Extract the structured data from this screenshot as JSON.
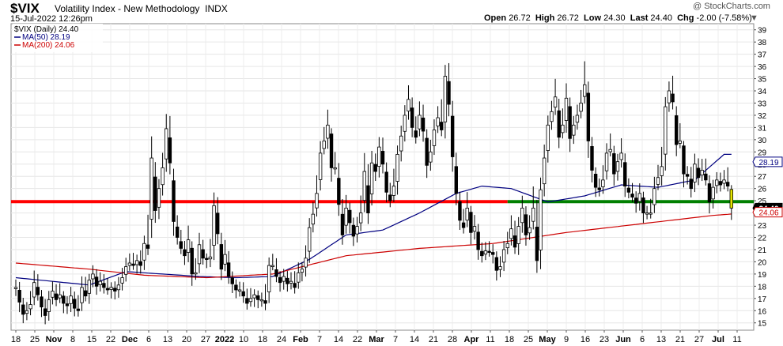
{
  "header": {
    "symbol": "$VIX",
    "name": "Volatility Index - New Methodology",
    "exchange": "INDX",
    "date": "15-Jul-2022 12:26pm",
    "watermark": "@ StockCharts.com",
    "open_label": "Open",
    "open": "26.72",
    "high_label": "High",
    "high": "26.72",
    "low_label": "Low",
    "low": "24.30",
    "last_label": "Last",
    "last": "24.40",
    "chg_label": "Chg",
    "chg": "-2.00 (-7.58%)",
    "menu_icon": "caret-down-icon"
  },
  "chart_data": {
    "type": "candlestick",
    "legend": {
      "placement": "top-left",
      "items": [
        "$VIX (Daily) 24.40",
        "MA(50) 28.19",
        "MA(200) 24.06"
      ]
    },
    "y_axis": {
      "side": "right",
      "min": 15,
      "max": 39,
      "ticks": [
        15,
        16,
        17,
        18,
        19,
        20,
        21,
        22,
        23,
        24,
        25,
        26,
        27,
        28,
        29,
        30,
        31,
        32,
        33,
        34,
        35,
        36,
        37,
        38,
        39
      ]
    },
    "x_axis_labels": [
      "18",
      "25",
      "Nov",
      "8",
      "15",
      "22",
      "Dec",
      "6",
      "13",
      "20",
      "27",
      "2022",
      "10",
      "18",
      "24",
      "Feb",
      "7",
      "14",
      "22",
      "Mar",
      "7",
      "14",
      "21",
      "28",
      "Apr",
      "11",
      "18",
      "25",
      "May",
      "9",
      "16",
      "23",
      "Jun",
      "6",
      "13",
      "21",
      "27",
      "Jul",
      "11"
    ],
    "x_bold_labels": [
      "Nov",
      "Dec",
      "2022",
      "Feb",
      "Mar",
      "Apr",
      "May",
      "Jun",
      "Jul"
    ],
    "value_tags": [
      {
        "text": "28.19",
        "value": 28.19,
        "color": "#000080",
        "style": "outline"
      },
      {
        "text": "24.40",
        "value": 24.4,
        "color": "#000000",
        "style": "filled"
      },
      {
        "text": "24.06",
        "value": 24.06,
        "color": "#cc0000",
        "style": "outline"
      }
    ],
    "support_line": {
      "value": 24.93,
      "red_segment": "18-Oct-2021 to 25-Apr-2022",
      "green_segment": "25-Apr-2022 to 15-Jul-2022",
      "red_color": "#ff0000",
      "green_color": "#008000"
    },
    "closes": [
      17.9,
      16.7,
      15.7,
      16.0,
      16.5,
      18.3,
      17.3,
      16.3,
      15.6,
      16.9,
      17.6,
      16.9,
      17.3,
      16.6,
      16.4,
      17.2,
      16.2,
      16.0,
      17.9,
      17.2,
      18.5,
      19.0,
      18.0,
      18.4,
      17.9,
      17.7,
      17.9,
      17.6,
      18.1,
      18.7,
      19.6,
      19.9,
      19.7,
      20.1,
      19.7,
      21.5,
      21.1,
      28.5,
      24.2,
      26.0,
      27.7,
      30.9,
      28.1,
      23.3,
      22.0,
      21.1,
      20.5,
      21.8,
      19.0,
      19.1,
      21.4,
      20.3,
      20.2,
      20.4,
      24.6,
      22.3,
      19.4,
      20.6,
      18.8,
      18.2,
      17.7,
      17.7,
      17.2,
      16.6,
      17.0,
      17.3,
      16.9,
      16.9,
      16.6,
      19.7,
      19.7,
      18.8,
      18.3,
      18.8,
      18.2,
      18.4,
      17.9,
      19.1,
      19.4,
      20.3,
      22.8,
      23.9,
      25.6,
      28.9,
      29.9,
      31.2,
      27.7,
      27.7,
      24.7,
      22.2,
      24.4,
      23.2,
      22.1,
      22.9,
      24.0,
      27.4,
      24.0,
      28.1,
      27.4,
      29.4,
      28.0,
      25.7,
      25.0,
      26.2,
      28.8,
      30.3,
      32.0,
      33.3,
      31.0,
      30.2,
      32.0,
      30.7,
      27.9,
      29.0,
      30.8,
      31.8,
      30.8,
      35.2,
      32.9,
      28.6,
      25.6,
      23.4,
      22.8,
      24.4,
      22.4,
      22.9,
      21.0,
      20.5,
      20.9,
      20.8,
      20.6,
      19.3,
      19.6,
      21.0,
      21.5,
      22.7,
      21.2,
      22.9,
      24.4,
      22.2,
      22.8,
      24.4,
      20.1,
      25.9,
      28.5,
      31.2,
      32.3,
      33.5,
      30.2,
      31.2,
      33.4,
      30.1,
      31.2,
      32.0,
      33.0,
      34.5,
      29.9,
      27.5,
      26.1,
      25.9,
      26.7,
      28.9,
      29.2,
      27.2,
      28.2,
      28.9,
      26.2,
      25.7,
      25.3,
      24.8,
      25.6,
      24.0,
      24.0,
      24.0,
      26.0,
      26.9,
      27.8,
      32.7,
      34.0,
      33.1,
      29.6,
      29.9,
      27.2,
      27.0,
      26.0,
      28.0,
      26.9,
      27.5,
      26.7,
      24.9,
      26.1,
      26.7,
      26.3,
      26.7,
      26.2,
      24.4
    ],
    "ma50": [
      [
        0,
        18.7
      ],
      [
        10,
        18.4
      ],
      [
        20,
        18.1
      ],
      [
        30,
        19.2
      ],
      [
        40,
        19.0
      ],
      [
        50,
        18.8
      ],
      [
        60,
        18.7
      ],
      [
        70,
        18.8
      ],
      [
        80,
        20.2
      ],
      [
        90,
        22.2
      ],
      [
        100,
        22.6
      ],
      [
        110,
        24.0
      ],
      [
        120,
        25.6
      ],
      [
        127,
        26.2
      ],
      [
        135,
        26.0
      ],
      [
        145,
        24.9
      ],
      [
        155,
        25.4
      ],
      [
        165,
        26.3
      ],
      [
        175,
        26.1
      ],
      [
        185,
        26.7
      ],
      [
        193,
        28.8
      ],
      [
        198,
        28.8
      ],
      [
        203,
        28.2
      ]
    ],
    "ma200": [
      [
        0,
        19.9
      ],
      [
        20,
        19.4
      ],
      [
        35,
        18.9
      ],
      [
        52,
        18.7
      ],
      [
        70,
        19.0
      ],
      [
        90,
        20.5
      ],
      [
        110,
        21.1
      ],
      [
        130,
        21.5
      ],
      [
        150,
        22.4
      ],
      [
        170,
        23.1
      ],
      [
        190,
        23.8
      ],
      [
        203,
        24.1
      ]
    ]
  }
}
